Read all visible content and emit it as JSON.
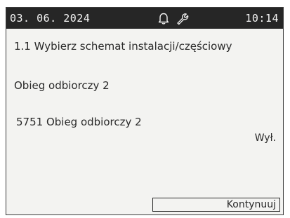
{
  "status_bar": {
    "date": "03. 06. 2024",
    "time": "10:14",
    "icons": [
      "bell-icon",
      "wrench-icon"
    ]
  },
  "screen": {
    "title": "1.1 Wybierz schemat instalacji/częściowy",
    "circuit_name": "Obieg odbiorczy 2",
    "parameter": {
      "label": "5751 Obieg odbiorczy 2",
      "value": "Wył."
    },
    "continue_label": "Kontynuuj"
  },
  "colors": {
    "status_bar_bg": "#262626",
    "screen_bg": "#f3f3f1",
    "text": "#2a2a2a"
  }
}
